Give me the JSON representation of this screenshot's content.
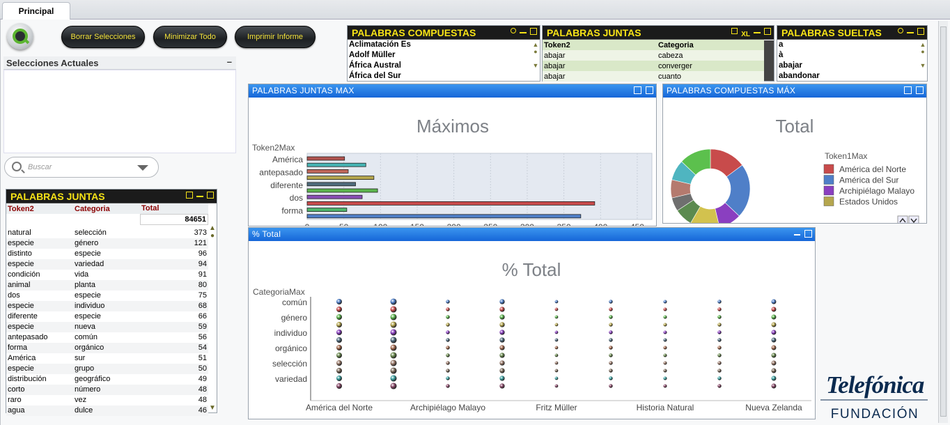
{
  "tabs": [
    {
      "label": "Principal"
    }
  ],
  "toolbar": {
    "clear": "Borrar Selecciones",
    "minimize": "Minimizar Todo",
    "print": "Imprimir Informe"
  },
  "current_selections": {
    "title": "Selecciones Actuales",
    "minimize": "–"
  },
  "search": {
    "placeholder": "Buscar"
  },
  "compuestas": {
    "title": "PALABRAS COMPUESTAS",
    "items": [
      "Aclimatación Es",
      "Adolf Müller",
      "África Austral",
      "África del Sur"
    ]
  },
  "juntas_top": {
    "title": "PALABRAS JUNTAS",
    "xl": "XL",
    "headers": [
      "Token2",
      "Categoria"
    ],
    "rows": [
      [
        "abajar",
        "cabeza"
      ],
      [
        "abajar",
        "converger"
      ],
      [
        "abajar",
        "cuanto"
      ]
    ]
  },
  "sueltas": {
    "title": "PALABRAS SUELTAS",
    "items": [
      "a",
      "à",
      "abajar",
      "abandonar"
    ]
  },
  "juntas_main": {
    "title": "PALABRAS JUNTAS",
    "headers": [
      "Token2",
      "Categoria",
      "Total"
    ],
    "total": "84651",
    "rows": [
      [
        "natural",
        "selección",
        "373"
      ],
      [
        "especie",
        "género",
        "121"
      ],
      [
        "distinto",
        "especie",
        "96"
      ],
      [
        "especie",
        "variedad",
        "94"
      ],
      [
        "condición",
        "vida",
        "91"
      ],
      [
        "animal",
        "planta",
        "80"
      ],
      [
        "dos",
        "especie",
        "75"
      ],
      [
        "especie",
        "individuo",
        "68"
      ],
      [
        "diferente",
        "especie",
        "66"
      ],
      [
        "especie",
        "nueva",
        "59"
      ],
      [
        "antepasado",
        "común",
        "56"
      ],
      [
        "forma",
        "orgánico",
        "54"
      ],
      [
        "América",
        "sur",
        "51"
      ],
      [
        "especie",
        "grupo",
        "50"
      ],
      [
        "distribución",
        "geográfico",
        "49"
      ],
      [
        "corto",
        "número",
        "48"
      ],
      [
        "raro",
        "vez",
        "48"
      ],
      [
        "agua",
        "dulce",
        "46"
      ]
    ]
  },
  "bar_panel": {
    "title": "PALABRAS JUNTAS MAX"
  },
  "pie_panel": {
    "title": "PALABRAS COMPUESTAS MÁX"
  },
  "scatter_panel": {
    "title": "% Total"
  },
  "chart_data": [
    {
      "type": "bar",
      "title": "Máximos",
      "ylabel": "Token2Max",
      "orientation": "horizontal",
      "categories": [
        "América",
        "antepasado",
        "diferente",
        "dos",
        "forma"
      ],
      "xlim": [
        0,
        470
      ],
      "xticks": [
        0,
        50,
        100,
        150,
        200,
        250,
        300,
        350,
        400,
        450
      ],
      "bars": [
        {
          "value": 51,
          "color": "#b0534f"
        },
        {
          "value": 80,
          "color": "#46b5b5"
        },
        {
          "value": 56,
          "color": "#c0675a"
        },
        {
          "value": 91,
          "color": "#b5a64e"
        },
        {
          "value": 66,
          "color": "#4f6b7d"
        },
        {
          "value": 96,
          "color": "#5cb54d"
        },
        {
          "value": 75,
          "color": "#8a4fb5"
        },
        {
          "value": 392,
          "color": "#c84b4b"
        },
        {
          "value": 54,
          "color": "#4fb56b"
        },
        {
          "value": 373,
          "color": "#4f7fc8"
        }
      ]
    },
    {
      "type": "pie",
      "title": "Total",
      "legend_title": "Token1Max",
      "legend_position": "right",
      "legend": [
        {
          "name": "América del Norte",
          "color": "#c84b4b"
        },
        {
          "name": "América del Sur",
          "color": "#4f7fc8"
        },
        {
          "name": "Archipiélago Malayo",
          "color": "#8a3fc0"
        },
        {
          "name": "Estados Unidos",
          "color": "#b5a64e"
        }
      ],
      "slices": [
        {
          "value": 16,
          "color": "#c84b4b"
        },
        {
          "value": 24,
          "color": "#4f7fc8"
        },
        {
          "value": 10,
          "color": "#8a3fc0"
        },
        {
          "value": 13,
          "color": "#d2c24e"
        },
        {
          "value": 8,
          "color": "#5b8a4f"
        },
        {
          "value": 6,
          "color": "#6f6f6f"
        },
        {
          "value": 8,
          "color": "#b57a6e"
        },
        {
          "value": 9,
          "color": "#4fb5c0"
        },
        {
          "value": 14,
          "color": "#5cc04d"
        }
      ]
    },
    {
      "type": "scatter",
      "title": "% Total",
      "ylabel": "CategoriaMax",
      "xlabel": "Token1Max",
      "y_ticks": [
        "común",
        "género",
        "individuo",
        "orgánico",
        "selección",
        "variedad"
      ],
      "x_ticks": [
        "América del Norte",
        "Archipiélago Malayo",
        "Fritz Müller",
        "Historia Natural",
        "Nueva Zelanda"
      ],
      "columns": 9,
      "rows": 12,
      "column_sizes": [
        1.0,
        1.15,
        0.65,
        0.9,
        0.55,
        0.65,
        0.6,
        0.65,
        0.85
      ],
      "row_colors": [
        "#4f7fc8",
        "#c84b4b",
        "#5cb54d",
        "#b5a64e",
        "#8a3fc0",
        "#4f6b7d",
        "#a36a4f",
        "#6a8a4f",
        "#9a7a6a",
        "#7a6a5a",
        "#3aa0a0",
        "#8a4a6a"
      ]
    }
  ]
}
